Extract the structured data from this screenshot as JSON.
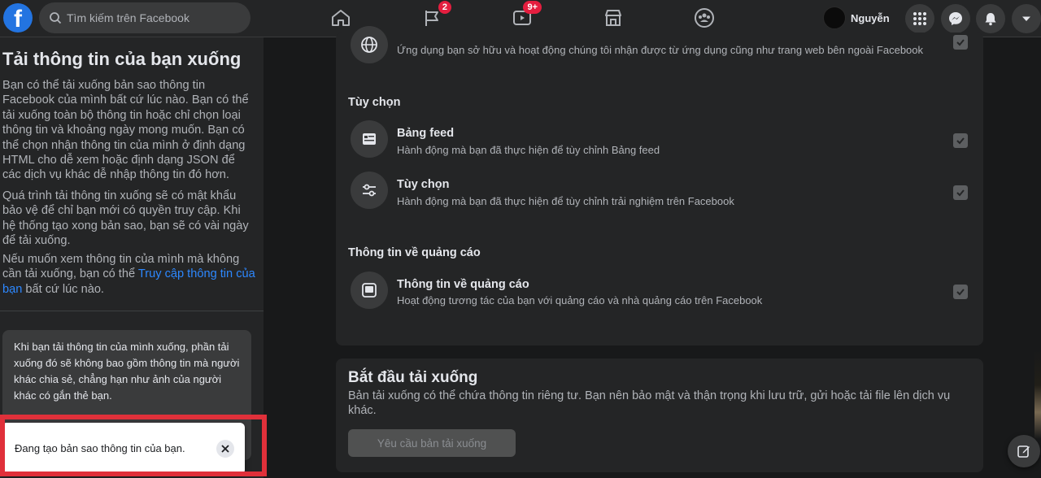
{
  "topbar": {
    "logo": "f",
    "search_placeholder": "Tìm kiếm trên Facebook",
    "pages_badge": "2",
    "watch_badge": "9+",
    "profile_name": "Nguyễn"
  },
  "sidebar": {
    "title": "Tải thông tin của bạn xuống",
    "para1": "Bạn có thể tải xuống bản sao thông tin Facebook của mình bất cứ lúc nào. Bạn có thể tải xuống toàn bộ thông tin hoặc chỉ chọn loại thông tin và khoảng ngày mong muốn. Bạn có thể chọn nhận thông tin của mình ở định dạng HTML cho dễ xem hoặc định dạng JSON để các dịch vụ khác dễ nhập thông tin đó hơn.",
    "para2": "Quá trình tải thông tin xuống sẽ có mật khẩu bảo vệ để chỉ bạn mới có quyền truy cập. Khi hệ thống tạo xong bản sao, bạn sẽ có vài ngày để tải xuống.",
    "para3_prefix": "Nếu muốn xem thông tin của mình mà không cần tải xuống, bạn có thể ",
    "para3_link": "Truy cập thông tin của bạn",
    "para3_suffix": " bất cứ lúc nào.",
    "info_card": "Khi bạn tải thông tin của mình xuống, phần tải xuống đó sẽ không bao gồm thông tin mà người khác chia sẻ, chẳng hạn như ảnh của người khác có gắn thẻ bạn."
  },
  "toast": {
    "text": "Đang tạo bản sao thông tin của bạn."
  },
  "main": {
    "partial_row_sub": "Ứng dụng bạn sở hữu và hoạt động chúng tôi nhận được từ ứng dụng cũng như trang web bên ngoài Facebook",
    "sections": [
      {
        "title": "Tùy chọn",
        "rows": [
          {
            "title": "Bảng feed",
            "sub": "Hành động mà bạn đã thực hiện để tùy chỉnh Bảng feed"
          },
          {
            "title": "Tùy chọn",
            "sub": "Hành động mà bạn đã thực hiện để tùy chỉnh trải nghiệm trên Facebook"
          }
        ]
      },
      {
        "title": "Thông tin về quảng cáo",
        "rows": [
          {
            "title": "Thông tin về quảng cáo",
            "sub": "Hoạt động tương tác của bạn với quảng cáo và nhà quảng cáo trên Facebook"
          }
        ]
      }
    ],
    "download": {
      "title": "Bắt đầu tải xuống",
      "desc": "Bản tải xuống có thể chứa thông tin riêng tư. Bạn nên bảo mật và thận trọng khi lưu trữ, gửi hoặc tải file lên dịch vụ khác.",
      "button": "Yêu cầu bản tải xuống"
    }
  },
  "colors": {
    "brand": "#2374e1",
    "link": "#2d88ff",
    "badge": "#e41e3f",
    "highlight_frame": "#e0303a"
  }
}
